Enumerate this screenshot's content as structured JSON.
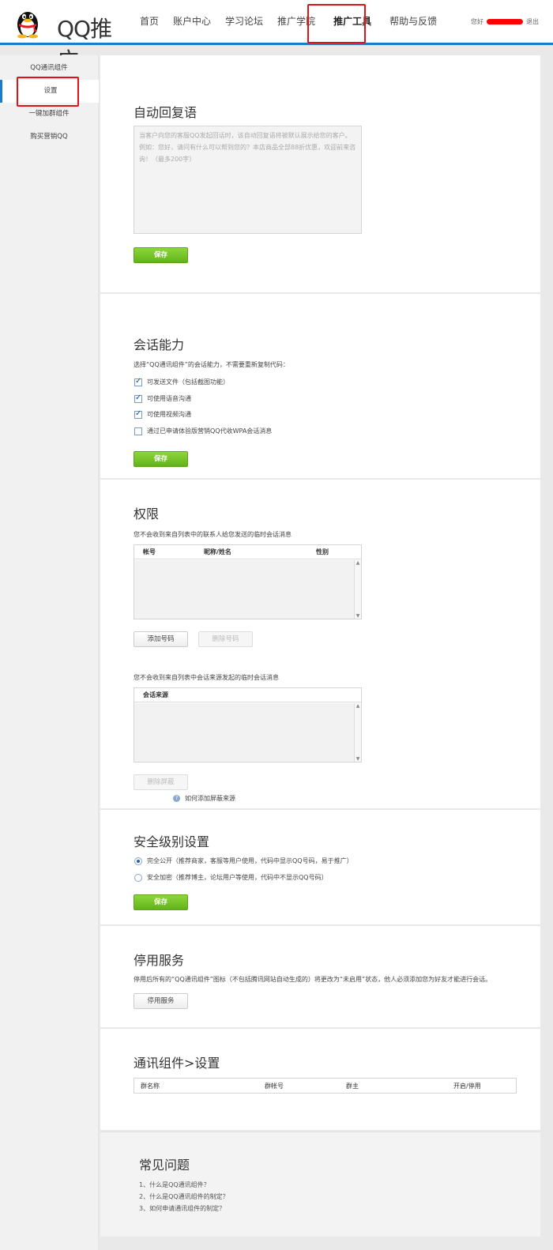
{
  "header": {
    "logo_text": "QQ推广",
    "nav": [
      "首页",
      "账户中心",
      "学习论坛",
      "推广学院",
      "推广工具",
      "帮助与反馈"
    ],
    "greeting": "您好",
    "logout": "退出"
  },
  "sidebar": {
    "items": [
      "QQ通讯组件",
      "设置",
      "一键加群组件",
      "购买营销QQ"
    ]
  },
  "auto_reply": {
    "title": "自动回复语",
    "placeholder": "当客户向您的客服QQ发起回话时，该自动回复语将被默认展示给您的客户。例如：您好，请问有什么可以帮到您的？本店商品全部88折优惠，欢迎前来咨询！（最多200字）",
    "save": "保存"
  },
  "session": {
    "title": "会话能力",
    "desc": "选择“QQ通讯组件”的会话能力，不需要重新复制代码：",
    "options": [
      {
        "label": "可发送文件（包括截图功能）",
        "checked": true
      },
      {
        "label": "可使用语音沟通",
        "checked": true
      },
      {
        "label": "可使用视频沟通",
        "checked": true
      },
      {
        "label": "通过已申请体验版营销QQ代收WPA会话消息",
        "checked": false
      }
    ],
    "save": "保存"
  },
  "permission": {
    "title": "权限",
    "desc1": "您不会收到来自列表中的联系人给您发送的临时会话消息",
    "cols1": [
      "帐号",
      "昵称/姓名",
      "性别"
    ],
    "add_btn": "添加号码",
    "del_btn": "删除号码",
    "desc2": "您不会收到来自列表中会话来源发起的临时会话消息",
    "cols2": [
      "会话来源"
    ],
    "del_block": "删除屏蔽",
    "help_link": "如何添加屏蔽来源"
  },
  "security": {
    "title": "安全级别设置",
    "options": [
      {
        "label": "完全公开（推荐商家，客服等用户使用，代码中显示QQ号码，易于推广）",
        "checked": true
      },
      {
        "label": "安全加密（推荐博主，论坛用户等使用，代码中不显示QQ号码）",
        "checked": false
      }
    ],
    "save": "保存"
  },
  "disable": {
    "title": "停用服务",
    "desc": "停用后所有的“QQ通讯组件”图标（不包括腾讯网站自动生成的）将更改为“未启用”状态，他人必须添加您为好友才能进行会话。",
    "btn": "停用服务"
  },
  "component_settings": {
    "title": "通讯组件>设置",
    "cols": [
      "群名称",
      "群帐号",
      "群主",
      "开启/停用"
    ]
  },
  "faq": {
    "title": "常见问题",
    "items": [
      "1、什么是QQ通讯组件？",
      "2、什么是QQ通讯组件的制定？",
      "3、如何申请通讯组件的制定？"
    ]
  }
}
